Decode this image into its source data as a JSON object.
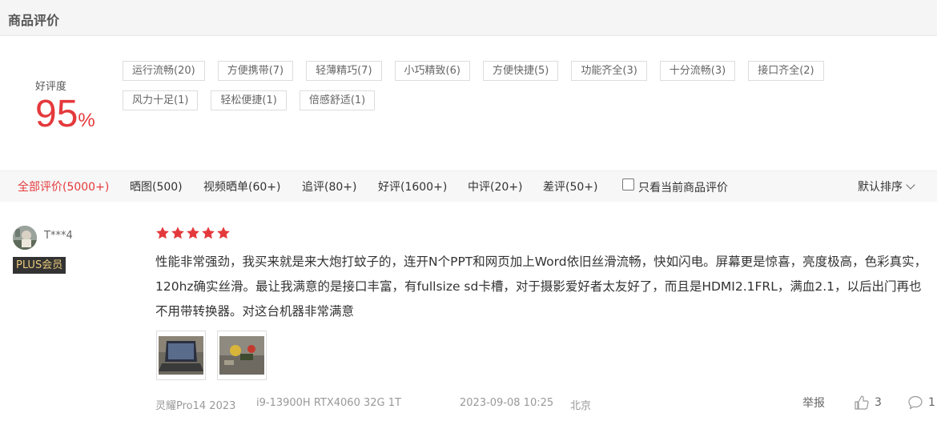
{
  "section": {
    "title": "商品评价"
  },
  "summary": {
    "rate_label": "好评度",
    "rate_value": "95",
    "rate_unit": "%",
    "tags": [
      "运行流畅(20)",
      "方便携带(7)",
      "轻薄精巧(7)",
      "小巧精致(6)",
      "方便快捷(5)",
      "功能齐全(3)",
      "十分流畅(3)",
      "接口齐全(2)",
      "风力十足(1)",
      "轻松便捷(1)",
      "倍感舒适(1)"
    ]
  },
  "filters": {
    "tabs": [
      "全部评价(5000+)",
      "晒图(500)",
      "视频晒单(60+)",
      "追评(80+)",
      "好评(1600+)",
      "中评(20+)",
      "差评(50+)"
    ],
    "only_current_label": "只看当前商品评价",
    "sort_label": "默认排序"
  },
  "review": {
    "username": "T***4",
    "badge": "PLUS会员",
    "stars": 5,
    "text": "性能非常强劲，我买来就是来大炮打蚊子的，连开N个PPT和网页加上Word依旧丝滑流畅，快如闪电。屏幕更是惊喜，亮度极高，色彩真实，120hz确实丝滑。最让我满意的是接口丰富，有fullsize sd卡槽，对于摄影爱好者太友好了，而且是HDMI2.1FRL，满血2.1，以后出门再也不用带转换器。对这台机器非常满意",
    "product_name": "灵耀Pro14 2023",
    "product_spec": "i9-13900H RTX4060 32G 1T",
    "datetime": "2023-09-08 10:25",
    "location": "北京",
    "report_label": "举报",
    "like_count": "3",
    "comment_count": "1"
  },
  "colors": {
    "accent": "#e4393c",
    "plus_gold": "#e9c97a"
  }
}
